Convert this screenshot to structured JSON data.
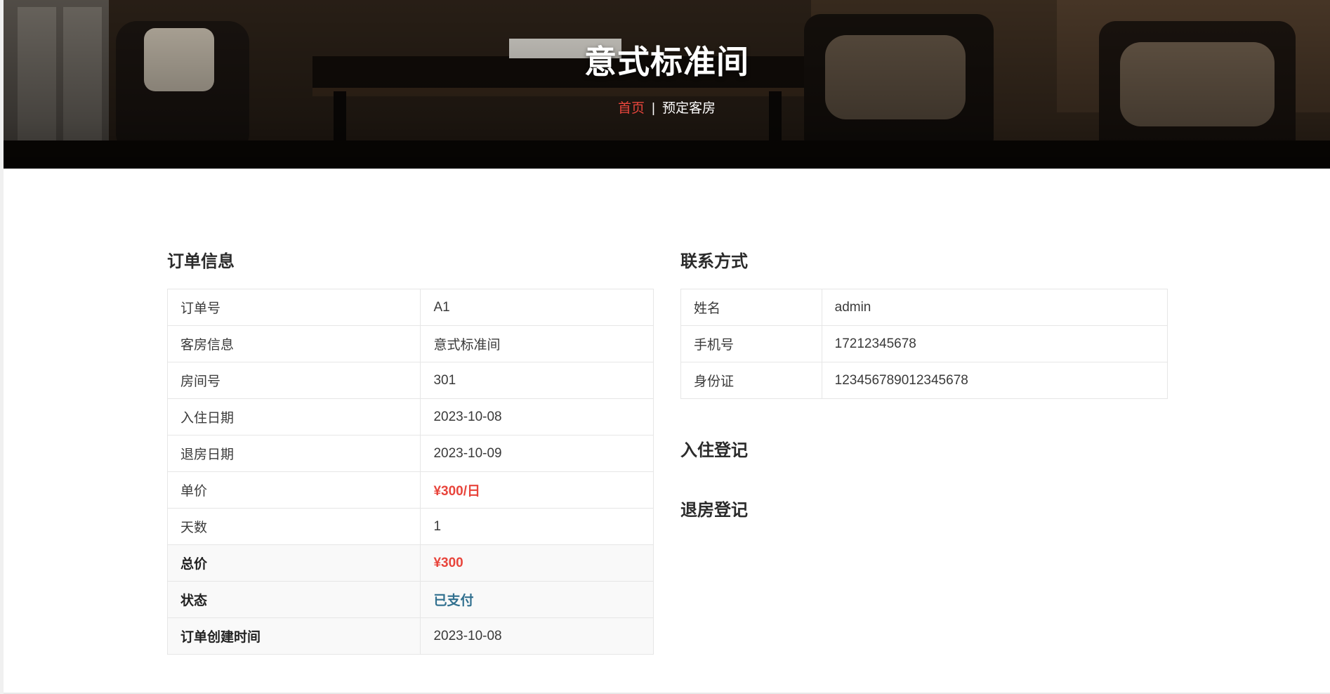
{
  "hero": {
    "title": "意式标准间",
    "breadcrumb": {
      "home": "首页",
      "separator": "|",
      "current": "预定客房"
    }
  },
  "order": {
    "title": "订单信息",
    "rows": [
      {
        "label": "订单号",
        "value": "A1"
      },
      {
        "label": "客房信息",
        "value": "意式标准间"
      },
      {
        "label": "房间号",
        "value": "301"
      },
      {
        "label": "入住日期",
        "value": "2023-10-08"
      },
      {
        "label": "退房日期",
        "value": "2023-10-09"
      },
      {
        "label": "单价",
        "value": "¥300/日"
      },
      {
        "label": "天数",
        "value": "1"
      },
      {
        "label": "总价",
        "value": "¥300"
      },
      {
        "label": "状态",
        "value": "已支付"
      },
      {
        "label": "订单创建时间",
        "value": "2023-10-08"
      }
    ]
  },
  "contact": {
    "title": "联系方式",
    "rows": [
      {
        "label": "姓名",
        "value": "admin"
      },
      {
        "label": "手机号",
        "value": "17212345678"
      },
      {
        "label": "身份证",
        "value": "123456789012345678"
      }
    ]
  },
  "checkin": {
    "title": "入住登记"
  },
  "checkout": {
    "title": "退房登记"
  },
  "colors": {
    "accent_red": "#e8453c",
    "status_blue": "#31708f",
    "border": "#e6e6e6"
  }
}
